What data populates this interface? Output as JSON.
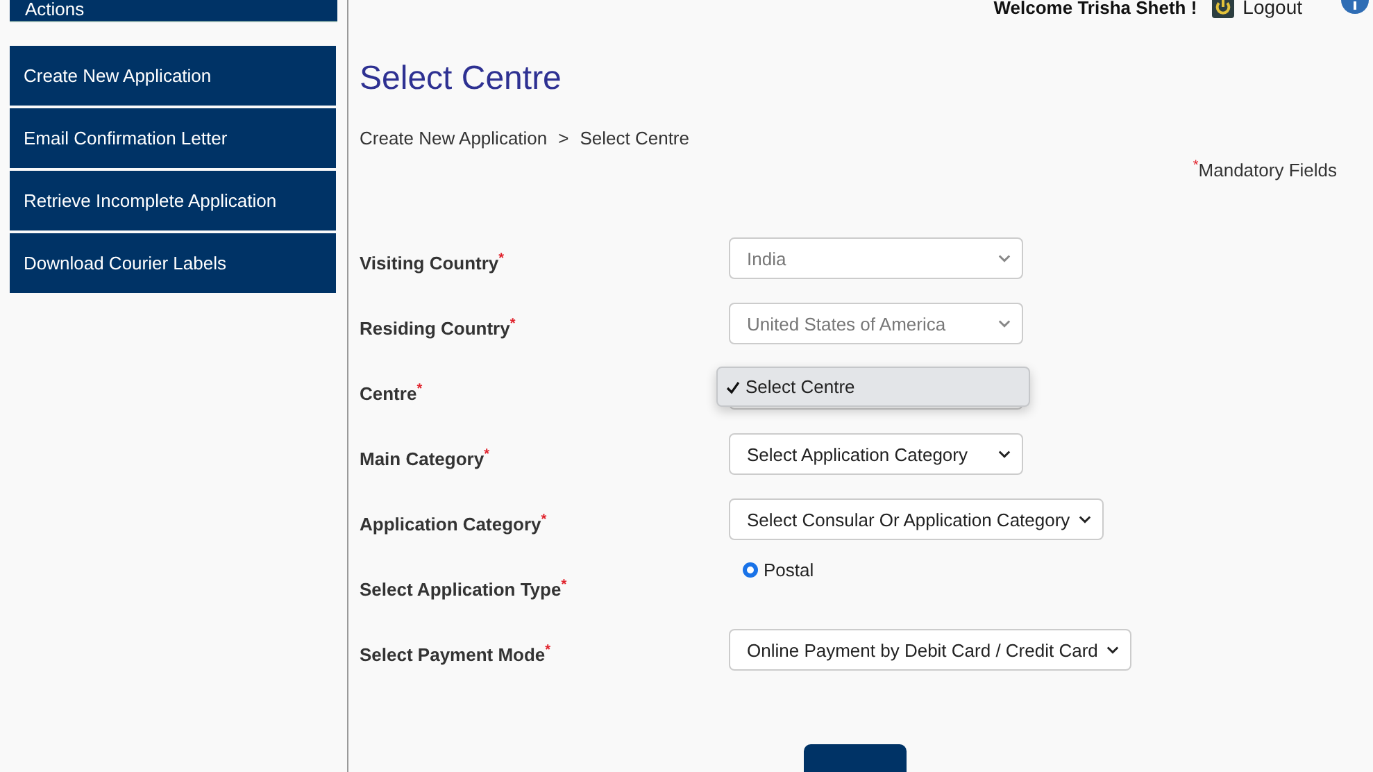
{
  "sidebar": {
    "header": "Actions",
    "items": [
      {
        "label": "Create New Application"
      },
      {
        "label": "Email Confirmation Letter"
      },
      {
        "label": "Retrieve Incomplete Application"
      },
      {
        "label": "Download Courier Labels"
      }
    ]
  },
  "header": {
    "welcome": "Welcome Trisha Sheth !",
    "logout": "Logout"
  },
  "title": "Select Centre",
  "breadcrumb": {
    "items": [
      "Create New Application",
      "Select Centre"
    ],
    "separator": ">"
  },
  "mandatory_note": {
    "mark": "*",
    "text": "Mandatory Fields"
  },
  "fields": [
    {
      "label": "Visiting Country",
      "required_mark": "*",
      "kind": "select",
      "value": "India",
      "disabled": true
    },
    {
      "label": "Residing Country",
      "required_mark": "*",
      "kind": "select",
      "value": "United States of America",
      "disabled": true
    },
    {
      "label": "Centre",
      "required_mark": "*",
      "kind": "dropdown-open",
      "options": [
        {
          "label": "Select Centre",
          "selected": true
        }
      ]
    },
    {
      "label": "Main Category",
      "required_mark": "*",
      "kind": "select",
      "value": "Select Application Category",
      "disabled": false
    },
    {
      "label": "Application Category",
      "required_mark": "*",
      "kind": "select",
      "value": "Select Consular Or Application Category",
      "disabled": false
    },
    {
      "label": "Select Application Type",
      "required_mark": "*",
      "kind": "radio",
      "options": [
        {
          "label": "Postal",
          "selected": true
        }
      ]
    },
    {
      "label": "Select Payment Mode",
      "required_mark": "*",
      "kind": "select",
      "value": "Online Payment by Debit Card / Credit Card",
      "disabled": false
    }
  ]
}
